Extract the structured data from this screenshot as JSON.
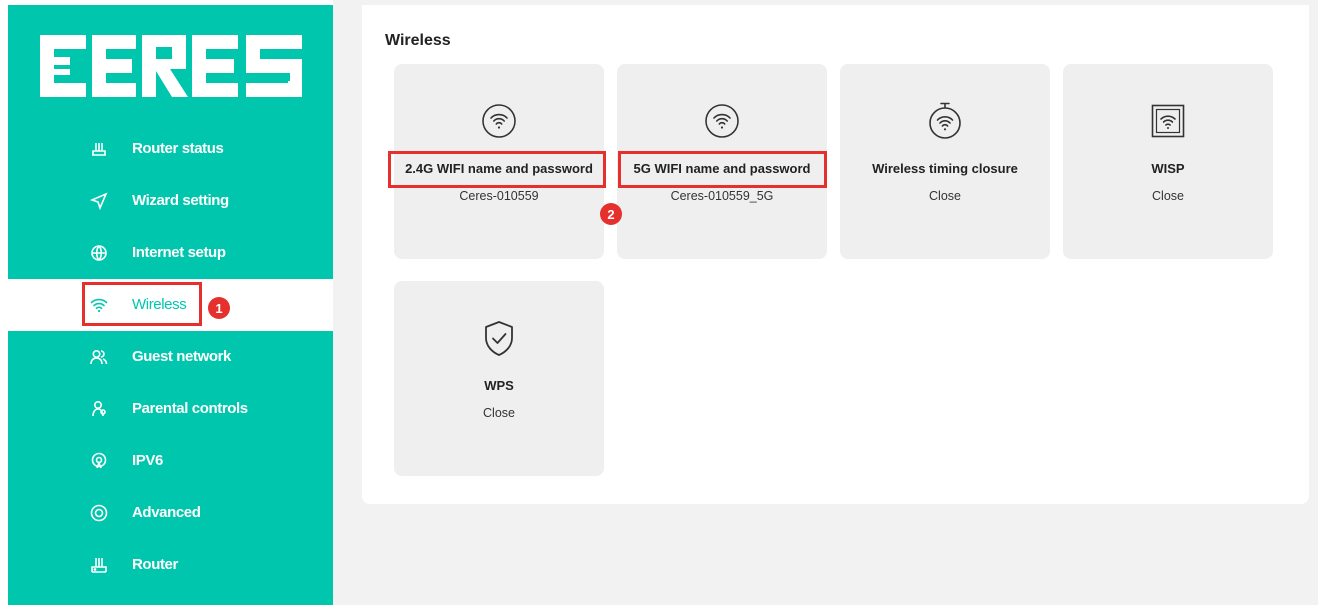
{
  "brand": {
    "logo_text": "CERES",
    "accent_color": "#00c6ad",
    "highlight_color": "#e5302d"
  },
  "sidebar": {
    "items": [
      {
        "label": "Router status",
        "icon": "router-status-icon"
      },
      {
        "label": "Wizard setting",
        "icon": "send-arrow-icon"
      },
      {
        "label": "Internet setup",
        "icon": "globe-icon"
      },
      {
        "label": "Wireless",
        "icon": "wifi-icon",
        "active": true
      },
      {
        "label": "Guest network",
        "icon": "guests-icon"
      },
      {
        "label": "Parental controls",
        "icon": "parent-child-icon"
      },
      {
        "label": "IPV6",
        "icon": "ipv6-icon"
      },
      {
        "label": "Advanced",
        "icon": "advanced-circle-icon"
      },
      {
        "label": "Router",
        "icon": "router-icon"
      }
    ]
  },
  "main": {
    "title": "Wireless",
    "cards": [
      {
        "title": "2.4G WIFI name and password",
        "value": "Ceres-010559",
        "icon": "wifi-circle-icon"
      },
      {
        "title": "5G WIFI name and password",
        "value": "Ceres-010559_5G",
        "icon": "wifi-circle-icon"
      },
      {
        "title": "Wireless timing closure",
        "value": "Close",
        "icon": "wifi-timer-icon"
      },
      {
        "title": "WISP",
        "value": "Close",
        "icon": "wisp-square-icon"
      },
      {
        "title": "WPS",
        "value": "Close",
        "icon": "shield-check-icon"
      }
    ]
  },
  "annotations": {
    "step1": "1",
    "step2": "2"
  }
}
